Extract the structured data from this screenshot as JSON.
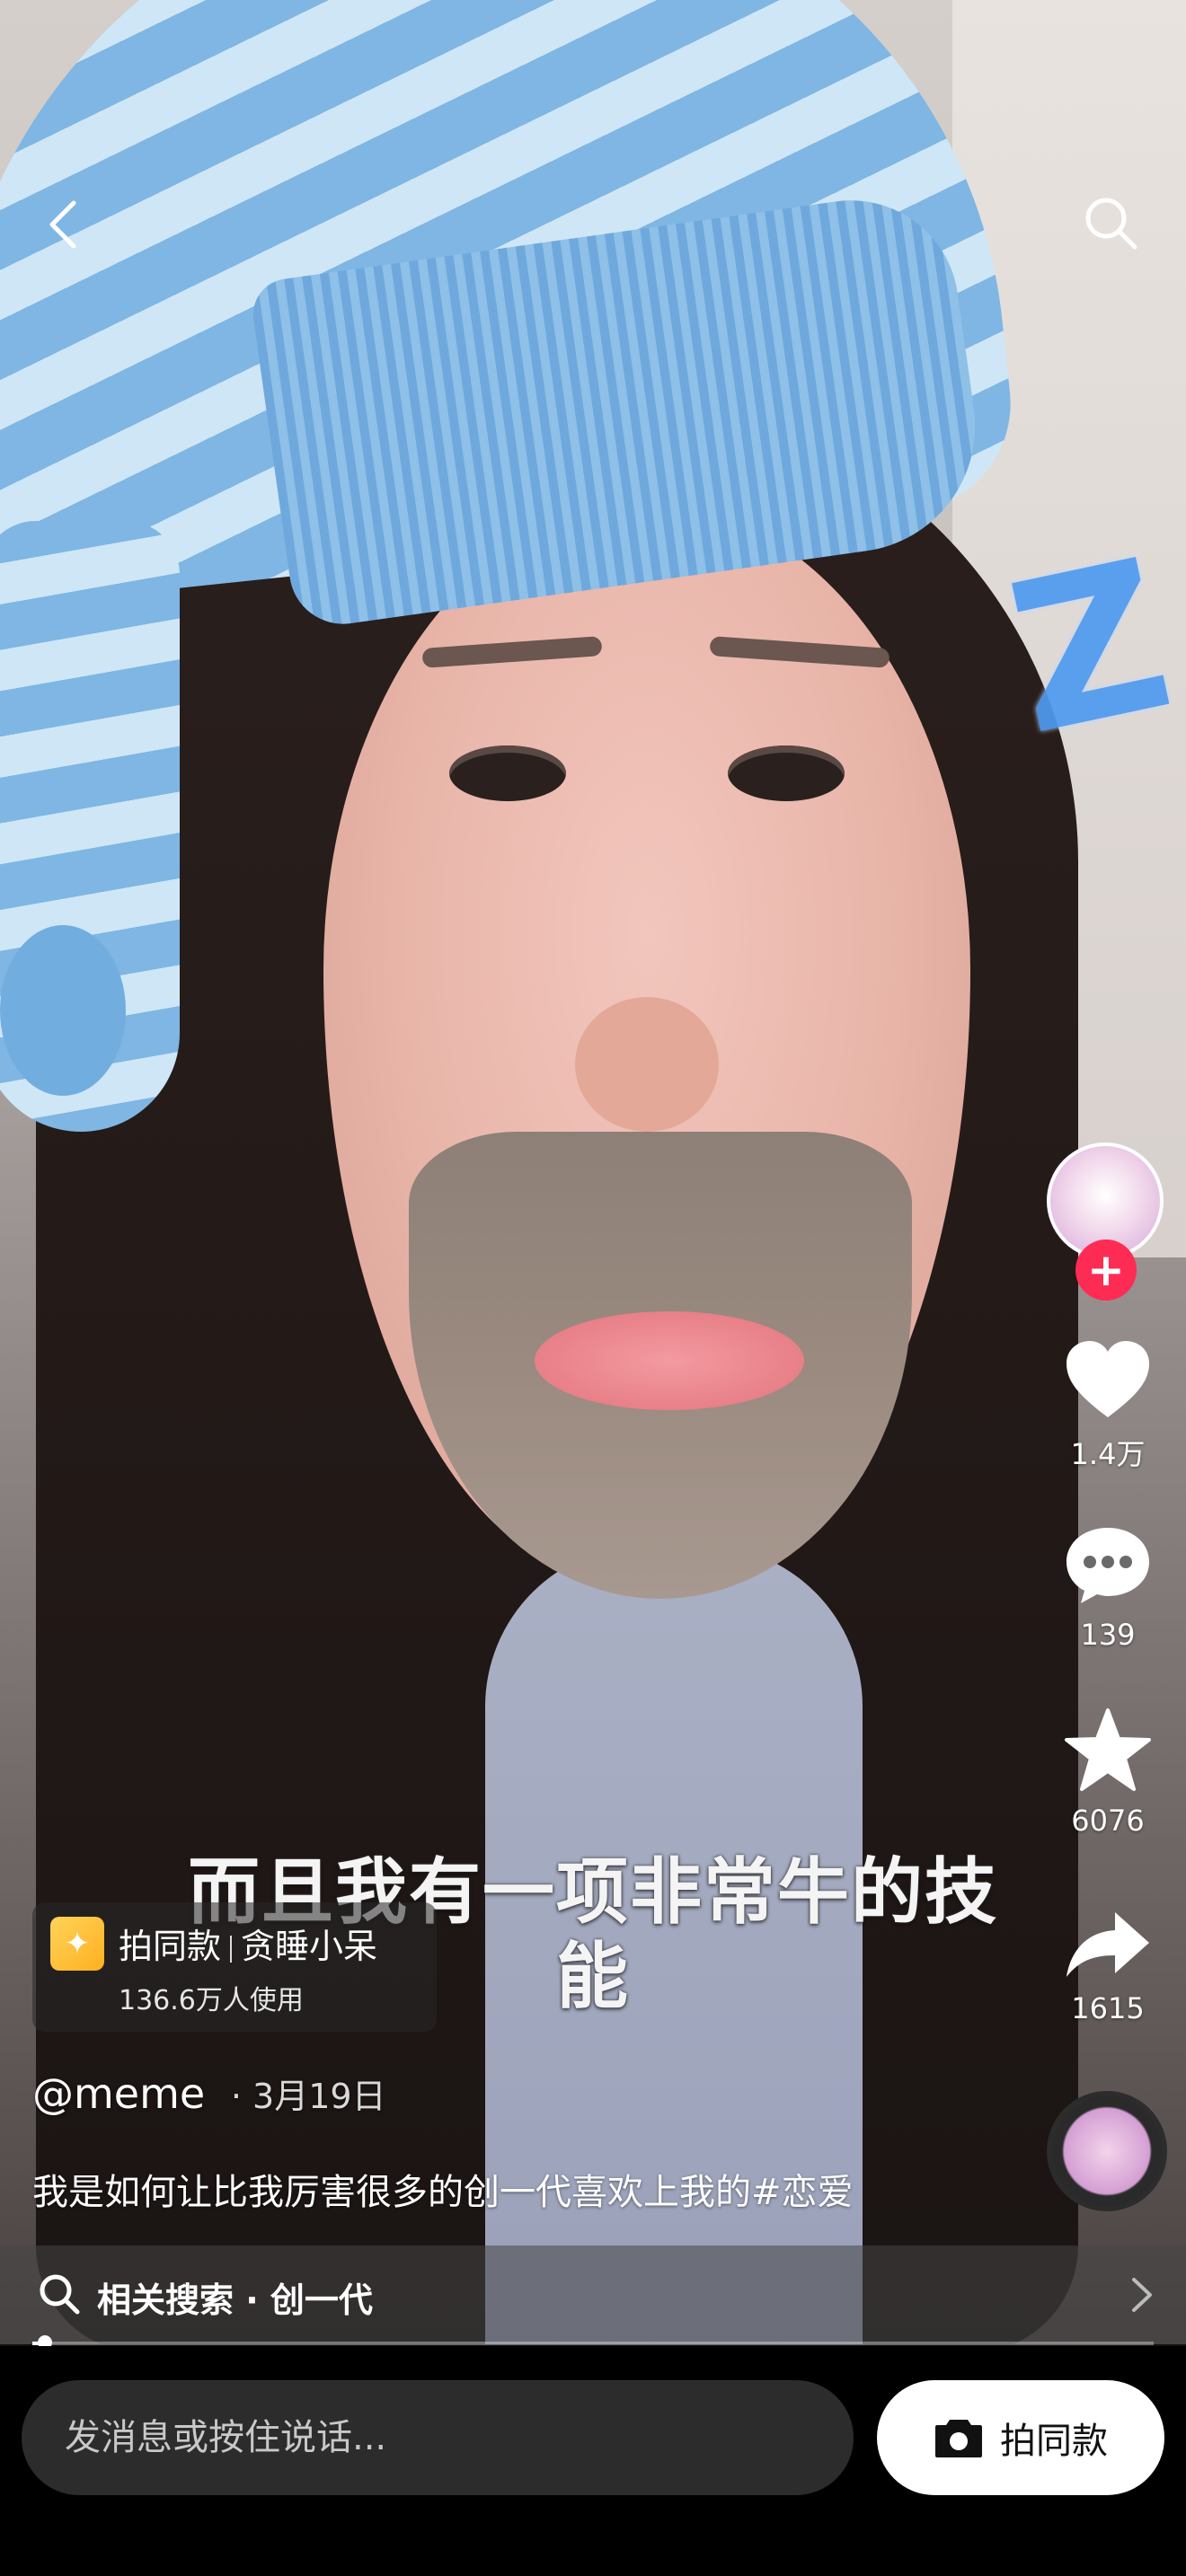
{
  "header": {
    "back_icon": "chevron-left-icon",
    "search_icon": "search-icon"
  },
  "video": {
    "subtitle": "而且我有一项非常牛的技能",
    "sticker_text": "Z"
  },
  "right_rail": {
    "follow_symbol": "+",
    "likes": "1.4万",
    "comments": "139",
    "favorites": "6076",
    "shares": "1615"
  },
  "effect": {
    "label": "拍同款",
    "name": "贪睡小呆",
    "usage": "136.6万人使用"
  },
  "post": {
    "author": "@meme",
    "separator": "·",
    "date": "3月19日",
    "caption": "我是如何让比我厉害很多的创一代喜欢上我的#恋爱"
  },
  "related_search": {
    "label": "相关搜索",
    "separator": "·",
    "query": "创一代"
  },
  "progress": {
    "fraction": 0.01
  },
  "bottom": {
    "message_placeholder": "发消息或按住说话...",
    "shoot_label": "拍同款"
  },
  "colors": {
    "accent": "#fe2c55",
    "sticker_blue": "#4f9bf0",
    "effect_icon": "#ffc030"
  }
}
